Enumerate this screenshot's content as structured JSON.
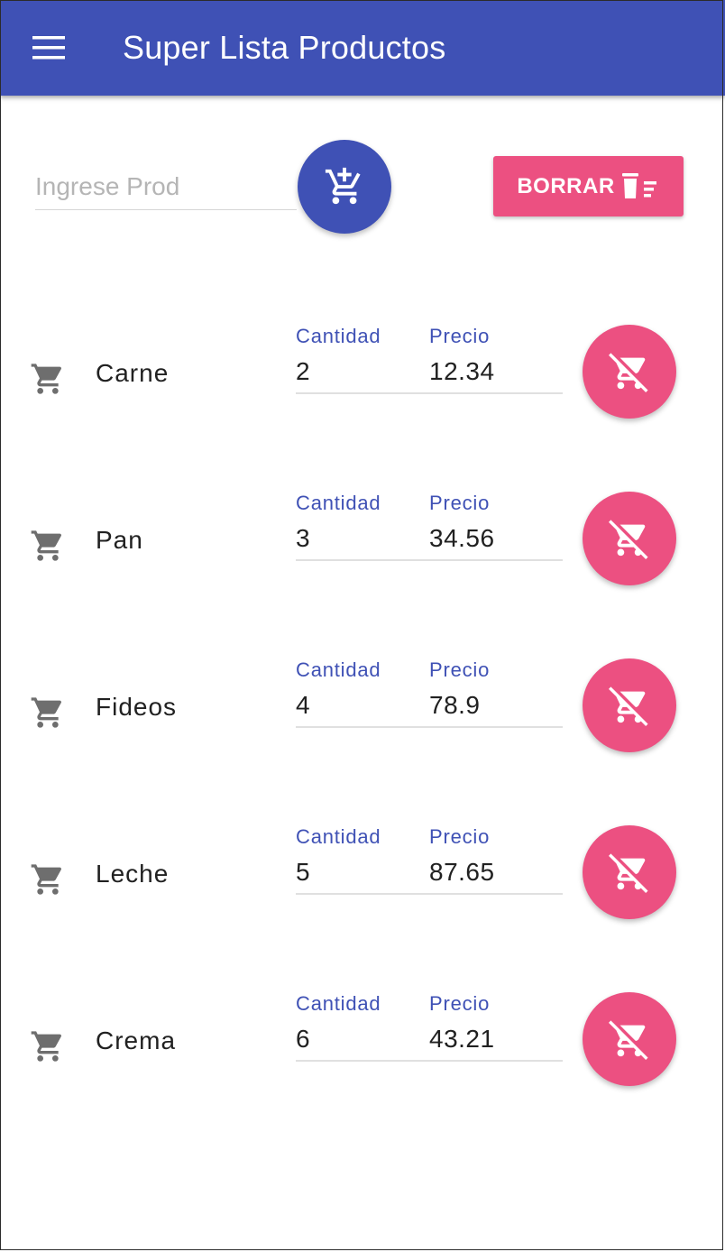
{
  "appbar": {
    "title": "Super Lista Productos",
    "menu_icon": "menu-icon",
    "color": "#3f51b5"
  },
  "form": {
    "input_placeholder": "Ingrese Prod",
    "input_value": "",
    "add_icon": "add-shopping-cart-icon",
    "clear_label": "BORRAR",
    "clear_icon": "delete-sweep-icon",
    "accent": "#ec5081"
  },
  "items": [
    {
      "name": "Carne",
      "qty_label": "Cantidad",
      "qty": "2",
      "price_label": "Precio",
      "price": "12.34"
    },
    {
      "name": "Pan",
      "qty_label": "Cantidad",
      "qty": "3",
      "price_label": "Precio",
      "price": "34.56"
    },
    {
      "name": "Fideos",
      "qty_label": "Cantidad",
      "qty": "4",
      "price_label": "Precio",
      "price": "78.9"
    },
    {
      "name": "Leche",
      "qty_label": "Cantidad",
      "qty": "5",
      "price_label": "Precio",
      "price": "87.65"
    },
    {
      "name": "Crema",
      "qty_label": "Cantidad",
      "qty": "6",
      "price_label": "Precio",
      "price": "43.21"
    }
  ],
  "item_icon": "shopping-cart-icon",
  "remove_icon": "remove-shopping-cart-icon"
}
